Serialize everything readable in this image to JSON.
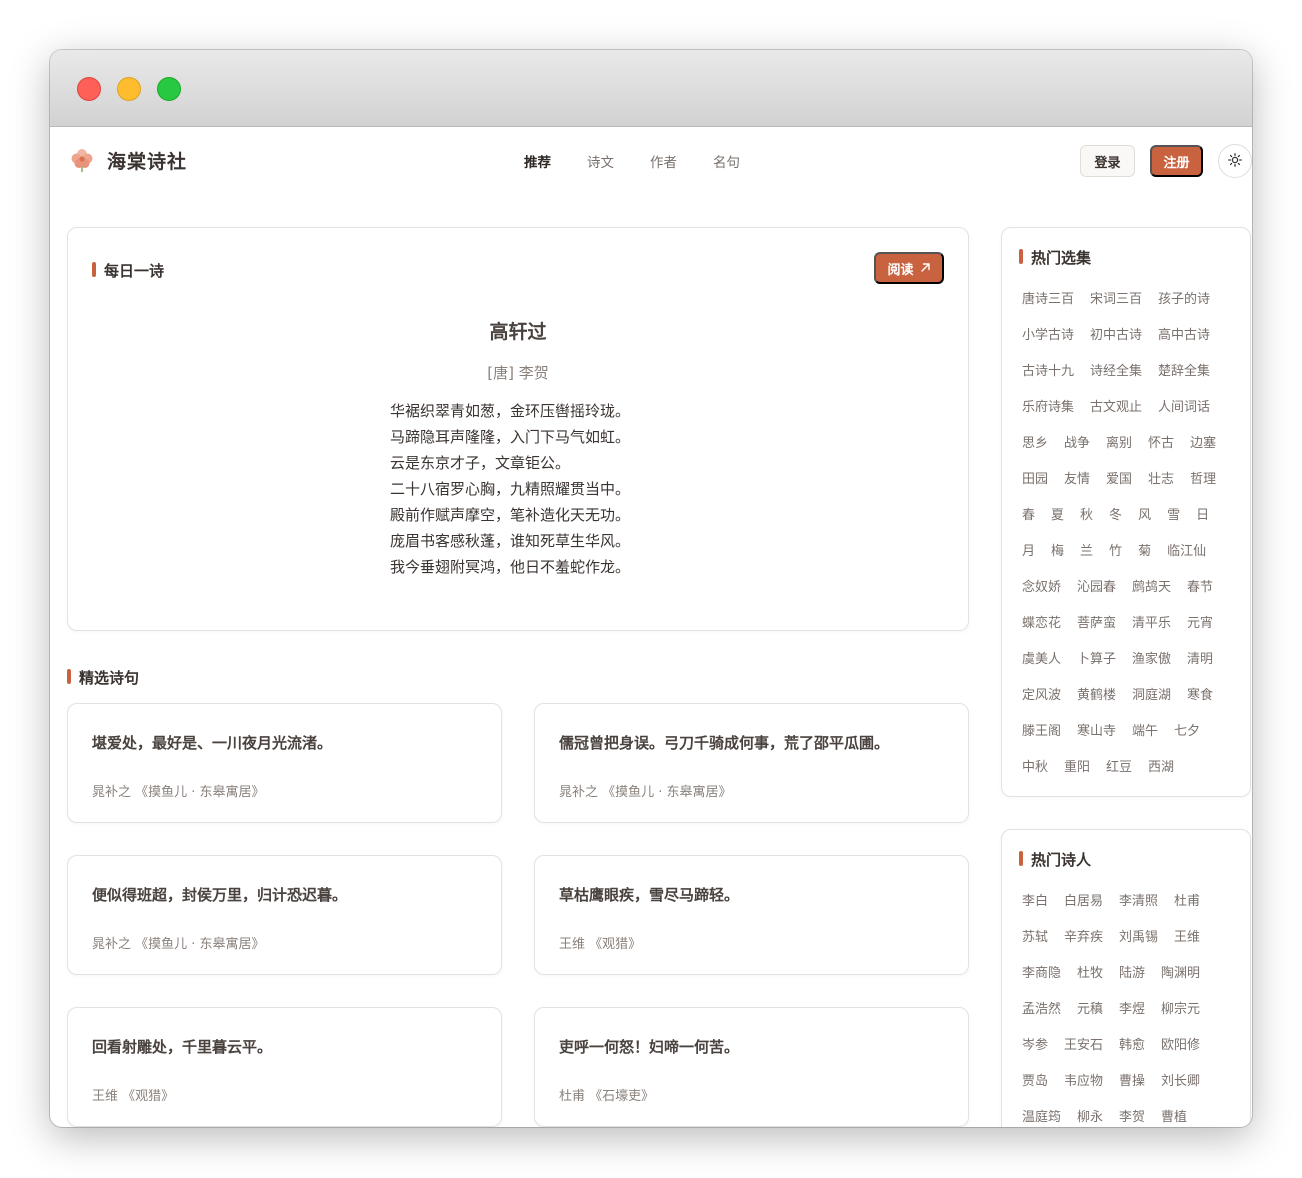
{
  "site": {
    "name": "海棠诗社"
  },
  "nav": {
    "items": [
      "推荐",
      "诗文",
      "作者",
      "名句"
    ],
    "active": 0
  },
  "header": {
    "login_label": "登录",
    "register_label": "注册"
  },
  "daily": {
    "section_title": "每日一诗",
    "read_label": "阅读",
    "title": "高轩过",
    "author": "[唐] 李贺",
    "lines": [
      "华裾织翠青如葱，金环压辔摇玲珑。",
      "马蹄隐耳声隆隆，入门下马气如虹。",
      "云是东京才子，文章钜公。",
      "二十八宿罗心胸，九精照耀贯当中。",
      "殿前作赋声摩空，笔补造化天无功。",
      "庞眉书客感秋蓬，谁知死草生华风。",
      "我今垂翅附冥鸿，他日不羞蛇作龙。"
    ]
  },
  "quotes": {
    "section_title": "精选诗句",
    "items": [
      {
        "text": "堪爱处，最好是、一川夜月光流渚。",
        "source": "晁补之 《摸鱼儿 · 东皋寓居》"
      },
      {
        "text": "儒冠曾把身误。弓刀千骑成何事，荒了邵平瓜圃。",
        "source": "晁补之 《摸鱼儿 · 东皋寓居》"
      },
      {
        "text": "便似得班超，封侯万里，归计恐迟暮。",
        "source": "晁补之 《摸鱼儿 · 东皋寓居》"
      },
      {
        "text": "草枯鹰眼疾，雪尽马蹄轻。",
        "source": "王维 《观猎》"
      },
      {
        "text": "回看射雕处，千里暮云平。",
        "source": "王维 《观猎》"
      },
      {
        "text": "吏呼一何怒！妇啼一何苦。",
        "source": "杜甫 《石壕吏》"
      }
    ]
  },
  "collections": {
    "section_title": "热门选集",
    "tags": [
      "唐诗三百",
      "宋词三百",
      "孩子的诗",
      "小学古诗",
      "初中古诗",
      "高中古诗",
      "古诗十九",
      "诗经全集",
      "楚辞全集",
      "乐府诗集",
      "古文观止",
      "人间词话",
      "思乡",
      "战争",
      "离别",
      "怀古",
      "边塞",
      "田园",
      "友情",
      "爱国",
      "壮志",
      "哲理",
      "春",
      "夏",
      "秋",
      "冬",
      "风",
      "雪",
      "日",
      "月",
      "梅",
      "兰",
      "竹",
      "菊",
      "临江仙",
      "念奴娇",
      "沁园春",
      "鹧鸪天",
      "春节",
      "蝶恋花",
      "菩萨蛮",
      "清平乐",
      "元宵",
      "虞美人",
      "卜算子",
      "渔家傲",
      "清明",
      "定风波",
      "黄鹤楼",
      "洞庭湖",
      "寒食",
      "滕王阁",
      "寒山寺",
      "端午",
      "七夕",
      "中秋",
      "重阳",
      "红豆",
      "西湖"
    ]
  },
  "poets": {
    "section_title": "热门诗人",
    "tags": [
      "李白",
      "白居易",
      "李清照",
      "杜甫",
      "苏轼",
      "辛弃疾",
      "刘禹锡",
      "王维",
      "李商隐",
      "杜牧",
      "陆游",
      "陶渊明",
      "孟浩然",
      "元稹",
      "李煜",
      "柳宗元",
      "岑参",
      "王安石",
      "韩愈",
      "欧阳修",
      "贾岛",
      "韦应物",
      "曹操",
      "刘长卿",
      "温庭筠",
      "柳永",
      "李贺",
      "曹植"
    ]
  },
  "colors": {
    "accent": "#c8623f",
    "text": "#3a3330",
    "muted": "#7a716c"
  },
  "icons": {
    "logo": "begonia-flower-icon",
    "theme": "sun-icon",
    "read": "arrow-up-right-icon"
  }
}
